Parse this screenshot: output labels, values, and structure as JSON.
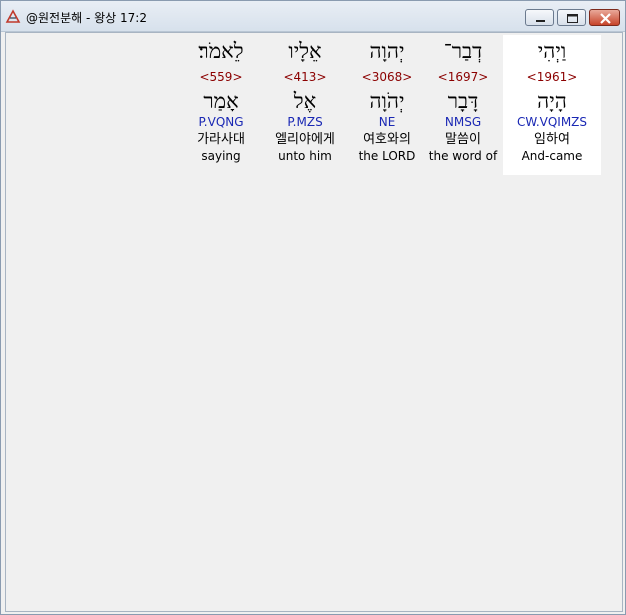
{
  "window": {
    "title": "@원전분해 - 왕상 17:2"
  },
  "words": [
    {
      "hebrew": "וַיְהִי",
      "strong": "<1961>",
      "lemma": "הָיָה",
      "parse": "CW.VQIMZS",
      "korean": "임하여",
      "english": "And-came",
      "selected": true
    },
    {
      "hebrew": "דְבַר־",
      "strong": "<1697>",
      "lemma": "דָּבָר",
      "parse": "NMSG",
      "korean": "말씀이",
      "english": "the word of",
      "selected": false
    },
    {
      "hebrew": "יְהוָה",
      "strong": "<3068>",
      "lemma": "יְהֹוָה",
      "parse": "NE",
      "korean": "여호와의",
      "english": "the LORD",
      "selected": false
    },
    {
      "hebrew": "אֵלָיו",
      "strong": "<413>",
      "lemma": "אֶל",
      "parse": "P.MZS",
      "korean": "엘리야에게",
      "english": "unto him",
      "selected": false
    },
    {
      "hebrew": "לֵאמֹר׃",
      "strong": "<559>",
      "lemma": "אָמַר",
      "parse": "P.VQNG",
      "korean": "가라사대",
      "english": "saying",
      "selected": false
    }
  ]
}
